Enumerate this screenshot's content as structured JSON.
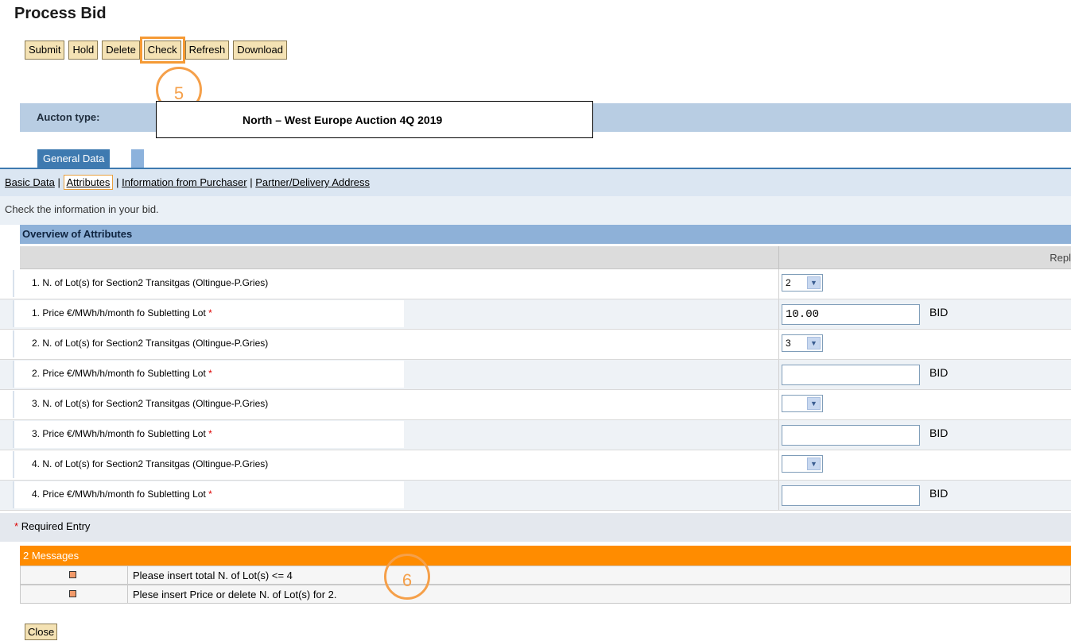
{
  "page": {
    "title": "Process Bid"
  },
  "toolbar": {
    "buttons": [
      {
        "label": "Submit"
      },
      {
        "label": "Hold"
      },
      {
        "label": "Delete"
      },
      {
        "label": "Check",
        "highlighted": true
      },
      {
        "label": "Refresh"
      },
      {
        "label": "Download"
      }
    ]
  },
  "callouts": {
    "step5": "5",
    "step6": "6"
  },
  "auction": {
    "label": "Aucton type:",
    "value": "North – West Europe Auction 4Q 2019"
  },
  "tabs": {
    "general": "General Data"
  },
  "subnav": {
    "basic": "Basic Data",
    "sep": "|",
    "attributes": "Attributes",
    "purchaser": "Information from Purchaser",
    "partner": "Partner/Delivery Address"
  },
  "check_info": "Check the information in your bid.",
  "overview": {
    "title": "Overview of Attributes",
    "col_right": "Repl"
  },
  "rows": [
    {
      "label": "1. N. of Lot(s) for Section2 Transitgas (Oltingue-P.Gries)",
      "type": "select",
      "value": "2"
    },
    {
      "label": "1. Price €/MWh/h/month fo Subletting Lot",
      "type": "input",
      "value": "10.00",
      "required": "*",
      "suffix": "BID"
    },
    {
      "label": "2. N. of Lot(s) for Section2 Transitgas (Oltingue-P.Gries)",
      "type": "select",
      "value": "3"
    },
    {
      "label": "2. Price €/MWh/h/month fo Subletting Lot",
      "type": "input",
      "value": "",
      "required": "*",
      "suffix": "BID"
    },
    {
      "label": "3. N. of Lot(s) for Section2 Transitgas (Oltingue-P.Gries)",
      "type": "select",
      "value": ""
    },
    {
      "label": "3. Price €/MWh/h/month fo Subletting Lot",
      "type": "input",
      "value": "",
      "required": "*",
      "suffix": "BID"
    },
    {
      "label": "4. N. of Lot(s) for Section2 Transitgas (Oltingue-P.Gries)",
      "type": "select",
      "value": ""
    },
    {
      "label": "4. Price €/MWh/h/month fo Subletting Lot",
      "type": "input",
      "value": "",
      "required": "*",
      "suffix": "BID"
    }
  ],
  "required_entry": {
    "mark": "*",
    "text": "Required Entry"
  },
  "messages": {
    "header": "2 Messages",
    "items": [
      {
        "text": "Please insert total N. of Lot(s) <= 4"
      },
      {
        "text": "Plese insert Price or delete N. of Lot(s) for 2."
      }
    ]
  },
  "close_label": "Close",
  "colors": {
    "accent": "#ff8c00",
    "tab": "#3e7ab0",
    "button": "#f4e2b4",
    "callout": "#f5a04a"
  }
}
